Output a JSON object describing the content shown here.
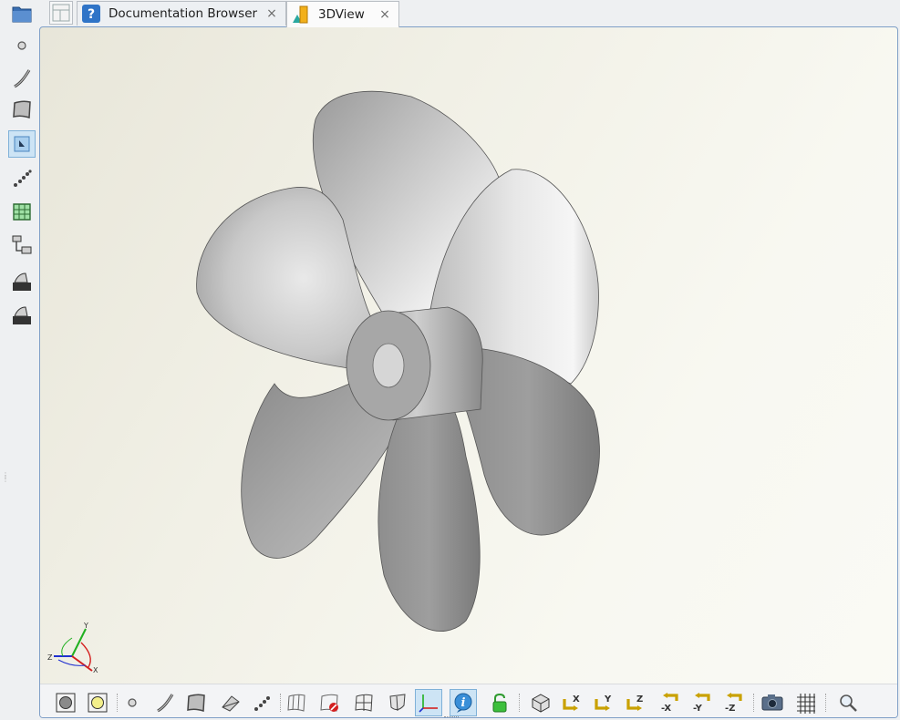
{
  "tabs": [
    {
      "label": "Documentation Browser",
      "icon": "help-icon",
      "close": "×"
    },
    {
      "label": "3DView",
      "icon": "3dview-icon",
      "close": "×"
    }
  ],
  "left_toolbar": {
    "items": [
      {
        "icon": "folder-icon"
      },
      {
        "icon": "point-icon"
      },
      {
        "icon": "curve-icon"
      },
      {
        "icon": "surface-icon"
      },
      {
        "icon": "select-mode-icon",
        "active": true
      },
      {
        "icon": "point-cloud-icon"
      },
      {
        "icon": "surface-patch-icon"
      },
      {
        "icon": "tree-icon"
      },
      {
        "icon": "shade-toggle-1-icon"
      },
      {
        "icon": "shade-toggle-2-icon"
      }
    ]
  },
  "bottom_toolbar": {
    "items": [
      {
        "icon": "select-object-icon"
      },
      {
        "icon": "select-face-icon"
      },
      {
        "icon": "point-icon"
      },
      {
        "icon": "curve-icon"
      },
      {
        "icon": "surface-icon"
      },
      {
        "icon": "plane-icon"
      },
      {
        "icon": "points-icon"
      },
      {
        "icon": "wireframe-icon"
      },
      {
        "icon": "hide-icon"
      },
      {
        "icon": "section-icon"
      },
      {
        "icon": "shield-icon"
      },
      {
        "icon": "axes-icon",
        "active": true
      },
      {
        "icon": "info-icon",
        "active": true
      },
      {
        "icon": "lock-icon"
      },
      {
        "icon": "isometric-view-icon"
      },
      {
        "icon": "view-x-icon",
        "label": "X"
      },
      {
        "icon": "view-y-icon",
        "label": "Y"
      },
      {
        "icon": "view-z-icon",
        "label": "Z"
      },
      {
        "icon": "view-minus-x-icon",
        "label": "-X"
      },
      {
        "icon": "view-minus-y-icon",
        "label": "-Y"
      },
      {
        "icon": "view-minus-z-icon",
        "label": "-Z"
      },
      {
        "icon": "camera-icon"
      },
      {
        "icon": "grid-icon"
      },
      {
        "icon": "zoom-icon"
      }
    ]
  },
  "axis_triad": {
    "x": "X",
    "y": "Y",
    "z": "Z"
  },
  "colors": {
    "frame": "#7f9fc7",
    "active": "#cde4f5",
    "axis_x": "#d42020",
    "axis_y": "#20b020",
    "axis_z": "#2030d0"
  }
}
